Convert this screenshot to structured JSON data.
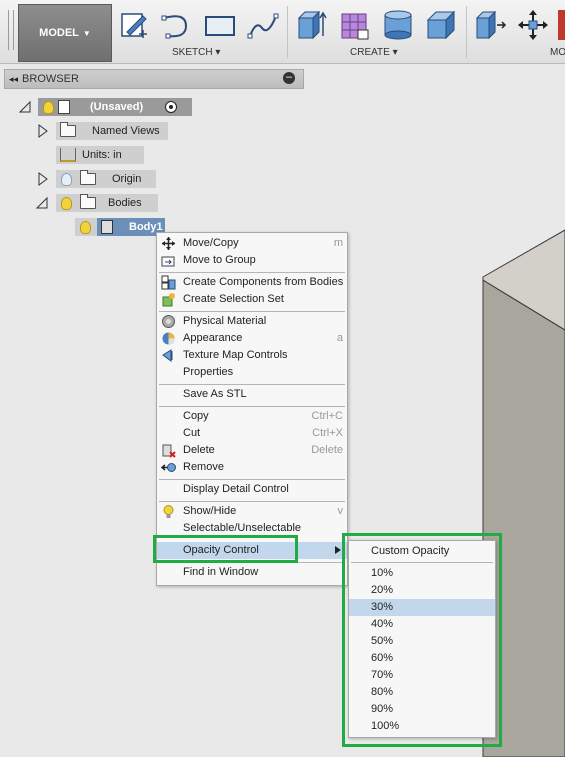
{
  "toolbar": {
    "workspace_label": "MODEL",
    "groups": [
      {
        "label": "SKETCH",
        "icons": [
          "sketch-create-icon",
          "arc-icon",
          "rectangle-icon",
          "spline-icon"
        ]
      },
      {
        "label": "CREATE",
        "icons": [
          "extrude-icon",
          "form-cage-icon",
          "cylinder-icon",
          "box-icon"
        ]
      },
      {
        "label": "MO",
        "icons": [
          "press-pull-icon",
          "move-icon",
          "fillet-icon"
        ]
      }
    ]
  },
  "browser": {
    "title": "BROWSER",
    "nodes": [
      {
        "label": "(Unsaved)"
      },
      {
        "label": "Named Views"
      },
      {
        "label": "Units: in"
      },
      {
        "label": "Origin"
      },
      {
        "label": "Bodies"
      },
      {
        "label": "Body1"
      }
    ]
  },
  "context_menu": {
    "items": [
      {
        "label": "Move/Copy",
        "shortcut": "m",
        "icon": "move-copy-icon"
      },
      {
        "label": "Move to Group",
        "shortcut": "",
        "icon": "move-to-group-icon"
      },
      {
        "label": "Create Components from Bodies",
        "shortcut": "",
        "icon": "create-components-icon"
      },
      {
        "label": "Create Selection Set",
        "shortcut": "",
        "icon": "selection-set-icon"
      },
      {
        "label": "Physical Material",
        "shortcut": "",
        "icon": "physical-material-icon"
      },
      {
        "label": "Appearance",
        "shortcut": "a",
        "icon": "appearance-icon"
      },
      {
        "label": "Texture Map Controls",
        "shortcut": "",
        "icon": "texture-map-icon"
      },
      {
        "label": "Properties",
        "shortcut": "",
        "icon": ""
      },
      {
        "label": "Save As STL",
        "shortcut": "",
        "icon": ""
      },
      {
        "label": "Copy",
        "shortcut": "Ctrl+C",
        "icon": ""
      },
      {
        "label": "Cut",
        "shortcut": "Ctrl+X",
        "icon": ""
      },
      {
        "label": "Delete",
        "shortcut": "Delete",
        "icon": "delete-icon"
      },
      {
        "label": "Remove",
        "shortcut": "",
        "icon": "remove-icon"
      },
      {
        "label": "Display Detail Control",
        "shortcut": "",
        "icon": ""
      },
      {
        "label": "Show/Hide",
        "shortcut": "v",
        "icon": "lightbulb-icon"
      },
      {
        "label": "Selectable/Unselectable",
        "shortcut": "",
        "icon": ""
      },
      {
        "label": "Opacity Control",
        "shortcut": "",
        "icon": ""
      },
      {
        "label": "Find in Window",
        "shortcut": "",
        "icon": ""
      }
    ]
  },
  "opacity_submenu": {
    "items": [
      "Custom Opacity",
      "10%",
      "20%",
      "30%",
      "40%",
      "50%",
      "60%",
      "70%",
      "80%",
      "90%",
      "100%"
    ],
    "highlighted": "30%"
  },
  "colors": {
    "highlight": "#c3d7ec",
    "annotation_green": "#22aa44",
    "selected_node": "#6b8fb8"
  }
}
